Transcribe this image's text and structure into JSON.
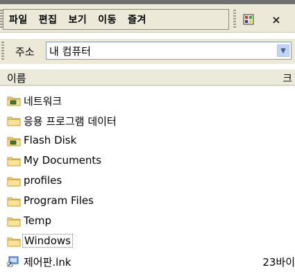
{
  "menubar": {
    "items": [
      {
        "label": "파일"
      },
      {
        "label": "편집"
      },
      {
        "label": "보기"
      },
      {
        "label": "이동"
      },
      {
        "label": "즐겨"
      }
    ],
    "extra_icon": "flag-icon",
    "close_label": "×"
  },
  "address": {
    "label": "주소",
    "value": "내 컴퓨터",
    "dropdown": "▼"
  },
  "columns": {
    "name": "이름",
    "size": "크"
  },
  "files": [
    {
      "name": "네트워크",
      "icon": "network-folder-icon",
      "size": ""
    },
    {
      "name": "응용 프로그램 데이터",
      "icon": "folder-icon",
      "size": ""
    },
    {
      "name": "Flash Disk",
      "icon": "network-folder-icon",
      "size": ""
    },
    {
      "name": "My Documents",
      "icon": "folder-icon",
      "size": ""
    },
    {
      "name": "profiles",
      "icon": "folder-icon",
      "size": ""
    },
    {
      "name": "Program Files",
      "icon": "folder-icon",
      "size": ""
    },
    {
      "name": "Temp",
      "icon": "folder-icon",
      "size": ""
    },
    {
      "name": "Windows",
      "icon": "folder-icon",
      "size": "",
      "focused": true
    },
    {
      "name": "제어판.lnk",
      "icon": "shortcut-icon",
      "size": "23바이"
    }
  ]
}
